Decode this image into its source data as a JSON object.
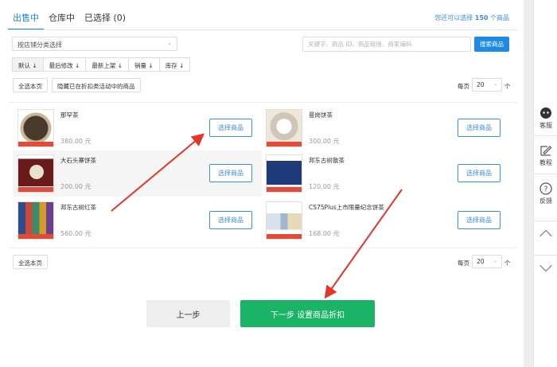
{
  "tabs": [
    {
      "label": "出售中",
      "active": true
    },
    {
      "label": "仓库中",
      "active": false
    },
    {
      "label": "已选择 (0)",
      "active": false
    }
  ],
  "quota": {
    "prefix": "您还可以选择",
    "count": "150",
    "suffix": "个商品"
  },
  "filters": {
    "category_select": "按店铺分类选择",
    "search_placeholder": "关键字、商品 ID、商品链接、商家编码",
    "search_button": "搜索商品"
  },
  "sort": [
    "默认 ↓",
    "最后修改 ↓",
    "最新上架 ↓",
    "销量 ↓",
    "库存 ↓"
  ],
  "select_bar": {
    "select_page": "全选本页",
    "hide_discounted": "隐藏已在折扣类活动中的商品",
    "per_page_label": "每页",
    "per_page_value": "20",
    "per_page_unit": "个"
  },
  "products": [
    {
      "name": "那罕茶",
      "price": "380.00 元",
      "action": "选择商品"
    },
    {
      "name": "曼岗饼茶",
      "price": "300.00 元",
      "action": "选择商品"
    },
    {
      "name": "大石头寨饼茶",
      "price": "200.00 元",
      "action": "选择商品"
    },
    {
      "name": "邦东古树散茶",
      "price": "120.00 元",
      "action": "选择商品"
    },
    {
      "name": "邦东古树红茶",
      "price": "560.00 元",
      "action": "选择商品"
    },
    {
      "name": "CS75Plus上市限量纪念饼茶",
      "price": "168.00 元",
      "action": "选择商品"
    }
  ],
  "footer": {
    "prev": "上一步",
    "next": "下一步 设置商品折扣"
  },
  "sidebar": {
    "service": "客服",
    "tutorial": "教程",
    "feedback": "反馈"
  },
  "colors": {
    "accent": "#1f8ae2",
    "primary_green": "#1bb466",
    "annotation_red": "#e5352b"
  }
}
